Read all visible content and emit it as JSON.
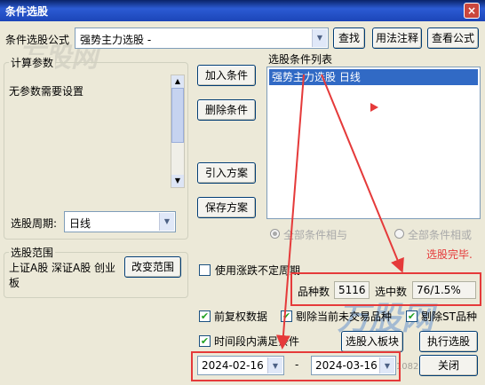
{
  "window": {
    "title": "条件选股",
    "close_label": "×"
  },
  "formula": {
    "label": "条件选股公式",
    "value": "强势主力选股 -",
    "find_label": "查找",
    "usage_label": "用法注释",
    "view_label": "查看公式"
  },
  "params": {
    "legend": "计算参数",
    "text": "无参数需要设置",
    "period_label": "选股周期:",
    "period_value": "日线"
  },
  "actions": {
    "add": "加入条件",
    "remove": "删除条件",
    "import": "引入方案",
    "save": "保存方案"
  },
  "conditions": {
    "legend": "选股条件列表",
    "items": [
      "强势主力选股  日线"
    ],
    "mode_and": "全部条件相与",
    "mode_or": "全部条件相或"
  },
  "scope": {
    "legend": "选股范围",
    "text": "上证A股 深证A股 创业板",
    "change_label": "改变范围"
  },
  "results": {
    "use_limit_label": "使用涨跌不定周期",
    "done_text": "选股完毕.",
    "count_label": "品种数",
    "count_value": "5116",
    "selected_label": "选中数",
    "selected_value": "76/1.5%"
  },
  "options": {
    "fq_label": "前复权数据",
    "exclude_untraded_label": "剔除当前未交易品种",
    "exclude_st_label": "剔除ST品种",
    "period_cond_label": "时间段内满足条件",
    "to_board_label": "选股入板块",
    "run_label": "执行选股",
    "close_label": "关闭"
  },
  "date_range": {
    "from": "2024-02-16",
    "sep": "-",
    "to": "2024-03-16"
  },
  "watermark": {
    "brand": "万股网",
    "url": "www.2011082.com"
  },
  "colors": {
    "accent_red": "#e53a3a",
    "selection_blue": "#316ac5",
    "check_green": "#21a121"
  }
}
